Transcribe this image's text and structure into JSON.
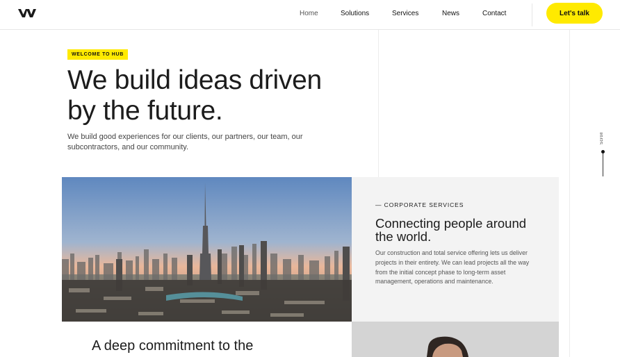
{
  "nav": {
    "items": [
      "Home",
      "Solutions",
      "Services",
      "News",
      "Contact"
    ],
    "cta_label": "Let's talk"
  },
  "hero": {
    "badge": "WELCOME TO HUB",
    "title_line1": "We build ideas driven",
    "title_line2": "by the future.",
    "subtitle": "We build good experiences for our clients, our partners, our team, our subcontractors, and our community."
  },
  "scroll": {
    "label": "Scroll"
  },
  "services": {
    "kicker": "— CORPORATE SERVICES",
    "title": "Connecting people around the world.",
    "text": "Our construction and total service offering lets us deliver projects in their entirety. We can lead projects all the way from the initial concept phase to long-term asset management, operations and maintenance."
  },
  "commitment": {
    "title": "A deep commitment to the"
  },
  "colors": {
    "accent": "#ffea00",
    "text": "#1c1c1c",
    "card_bg": "#f3f3f3"
  },
  "icons": {
    "logo": "w-logo-mark"
  }
}
